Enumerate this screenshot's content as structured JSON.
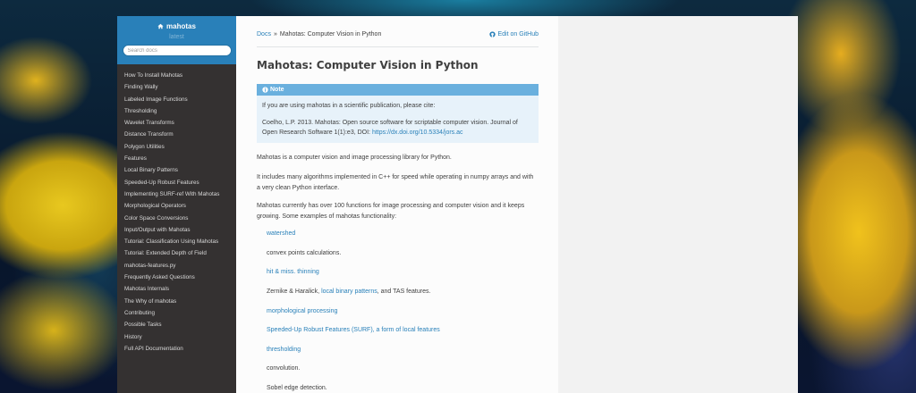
{
  "sidebar": {
    "project_name": "mahotas",
    "version": "latest",
    "search_placeholder": "Search docs",
    "items": [
      "How To Install Mahotas",
      "Finding Wally",
      "Labeled Image Functions",
      "Thresholding",
      "Wavelet Transforms",
      "Distance Transform",
      "Polygon Utilities",
      "Features",
      "Local Binary Patterns",
      "Speeded-Up Robust Features",
      "Implementing SURF-ref With Mahotas",
      "Morphological Operators",
      "Color Space Conversions",
      "Input/Output with Mahotas",
      "Tutorial: Classification Using Mahotas",
      "Tutorial: Extended Depth of Field",
      "mahotas-features.py",
      "Frequently Asked Questions",
      "Mahotas Internals",
      "The Why of mahotas",
      "Contributing",
      "Possible Tasks",
      "History",
      "Full API Documentation"
    ]
  },
  "breadcrumbs": {
    "docs": "Docs",
    "separator": "»",
    "current": "Mahotas: Computer Vision in Python",
    "github": "Edit on GitHub"
  },
  "main": {
    "title": "Mahotas: Computer Vision in Python",
    "note": {
      "title": "Note",
      "p1": "If you are using mahotas in a scientific publication, please cite:",
      "p2_text": "Coelho, L.P. 2013. Mahotas: Open source software for scriptable computer vision. Journal of Open Research Software 1(1):e3, DOI:",
      "p2_link": "https://dx.doi.org/10.5334/jors.ac"
    },
    "p1": "Mahotas is a computer vision and image processing library for Python.",
    "p2": "It includes many algorithms implemented in C++ for speed while operating in numpy arrays and with a very clean Python interface.",
    "p3": "Mahotas currently has over 100 functions for image processing and computer vision and it keeps growing. Some examples of mahotas functionality:",
    "list": {
      "watershed": "watershed",
      "convex": "convex points calculations.",
      "hitmiss": "hit & miss. thinning",
      "zernike_a": "Zernike & Haralick,",
      "zernike_link": "local binary patterns",
      "zernike_b": ", and TAS features.",
      "morph": "morphological processing",
      "surf": "Speeded-Up Robust Features (SURF), a form of local features",
      "thresh": "thresholding",
      "conv": "convolution.",
      "sobel": "Sobel edge detection."
    }
  },
  "colors": {
    "accent": "#2980b9",
    "sidebar_bg": "#343131",
    "note_header": "#6ab0de",
    "note_bg": "#e7f2fa"
  }
}
